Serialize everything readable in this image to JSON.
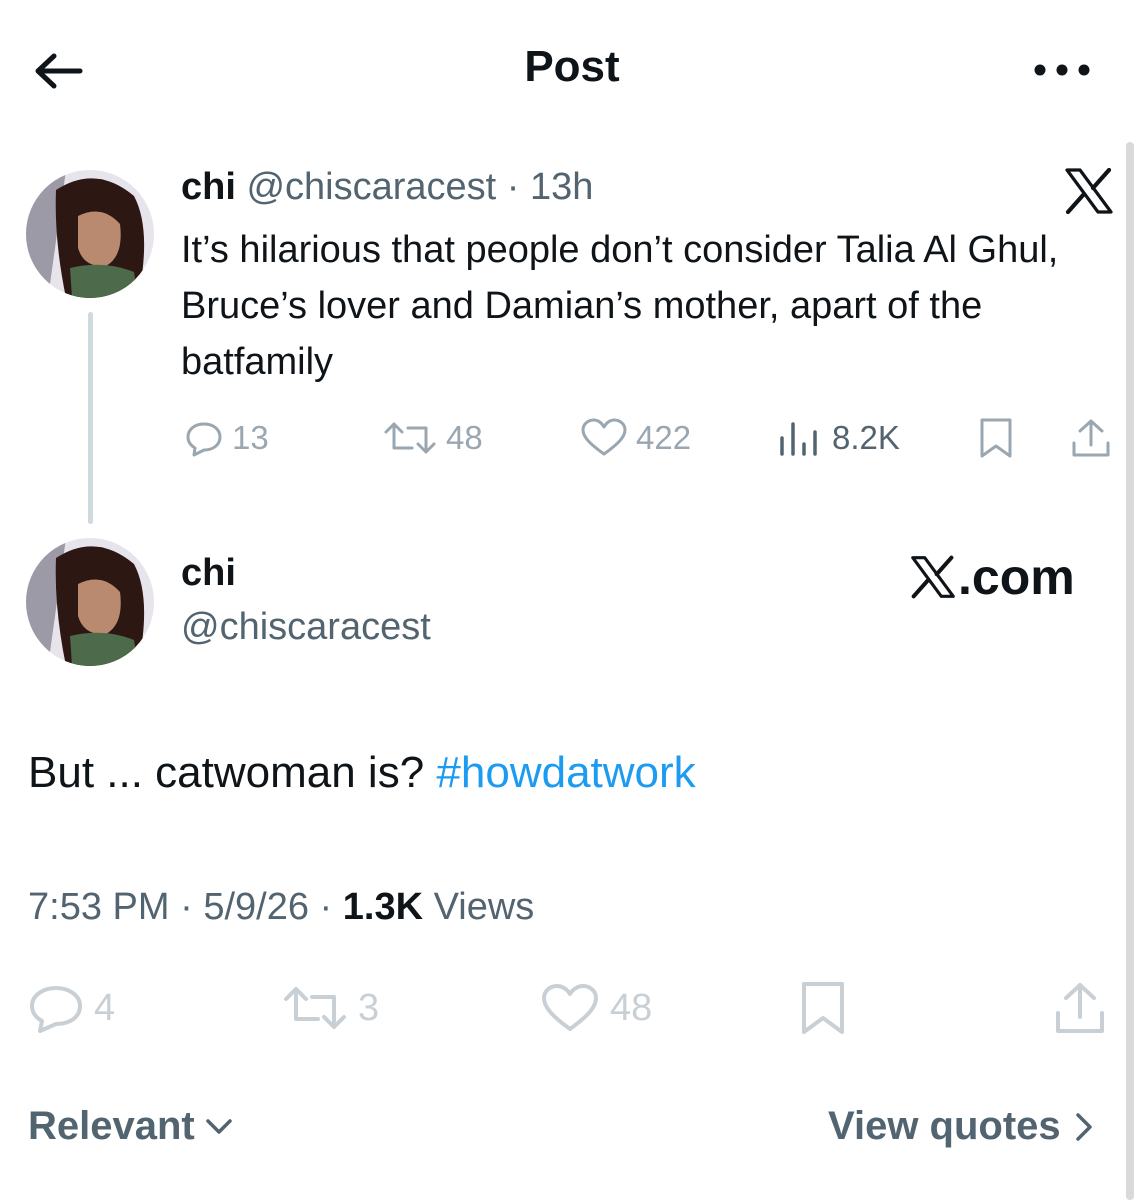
{
  "header": {
    "title": "Post",
    "back_icon": "arrow-left-icon",
    "more_icon": "more-horizontal-icon"
  },
  "quoted_tweet": {
    "name": "chi",
    "handle": "@chiscaracest",
    "separator": "·",
    "time": "13h",
    "text": "It’s hilarious that people don’t consider Talia Al Ghul, Bruce’s lover and Damian’s mother, apart of the batfamily",
    "actions": {
      "replies": "13",
      "reposts": "48",
      "likes": "422",
      "views": "8.2K"
    }
  },
  "main_tweet": {
    "name": "chi",
    "handle": "@chiscaracest",
    "brand_suffix": ".com",
    "text": "But ... catwoman is? ",
    "hashtag": "#howdatwork",
    "time": "7:53 PM",
    "sep1": " · ",
    "date": "5/9/26",
    "sep2": " · ",
    "views_count": "1.3K",
    "views_label": " Views",
    "actions": {
      "replies": "4",
      "reposts": "3",
      "likes": "48"
    }
  },
  "footer": {
    "sort_label": "Relevant",
    "quotes_label": "View quotes"
  },
  "colors": {
    "accent": "#1d9bf0",
    "muted": "#536471",
    "icon_muted": "#9aa7b1",
    "text": "#0f1419"
  }
}
